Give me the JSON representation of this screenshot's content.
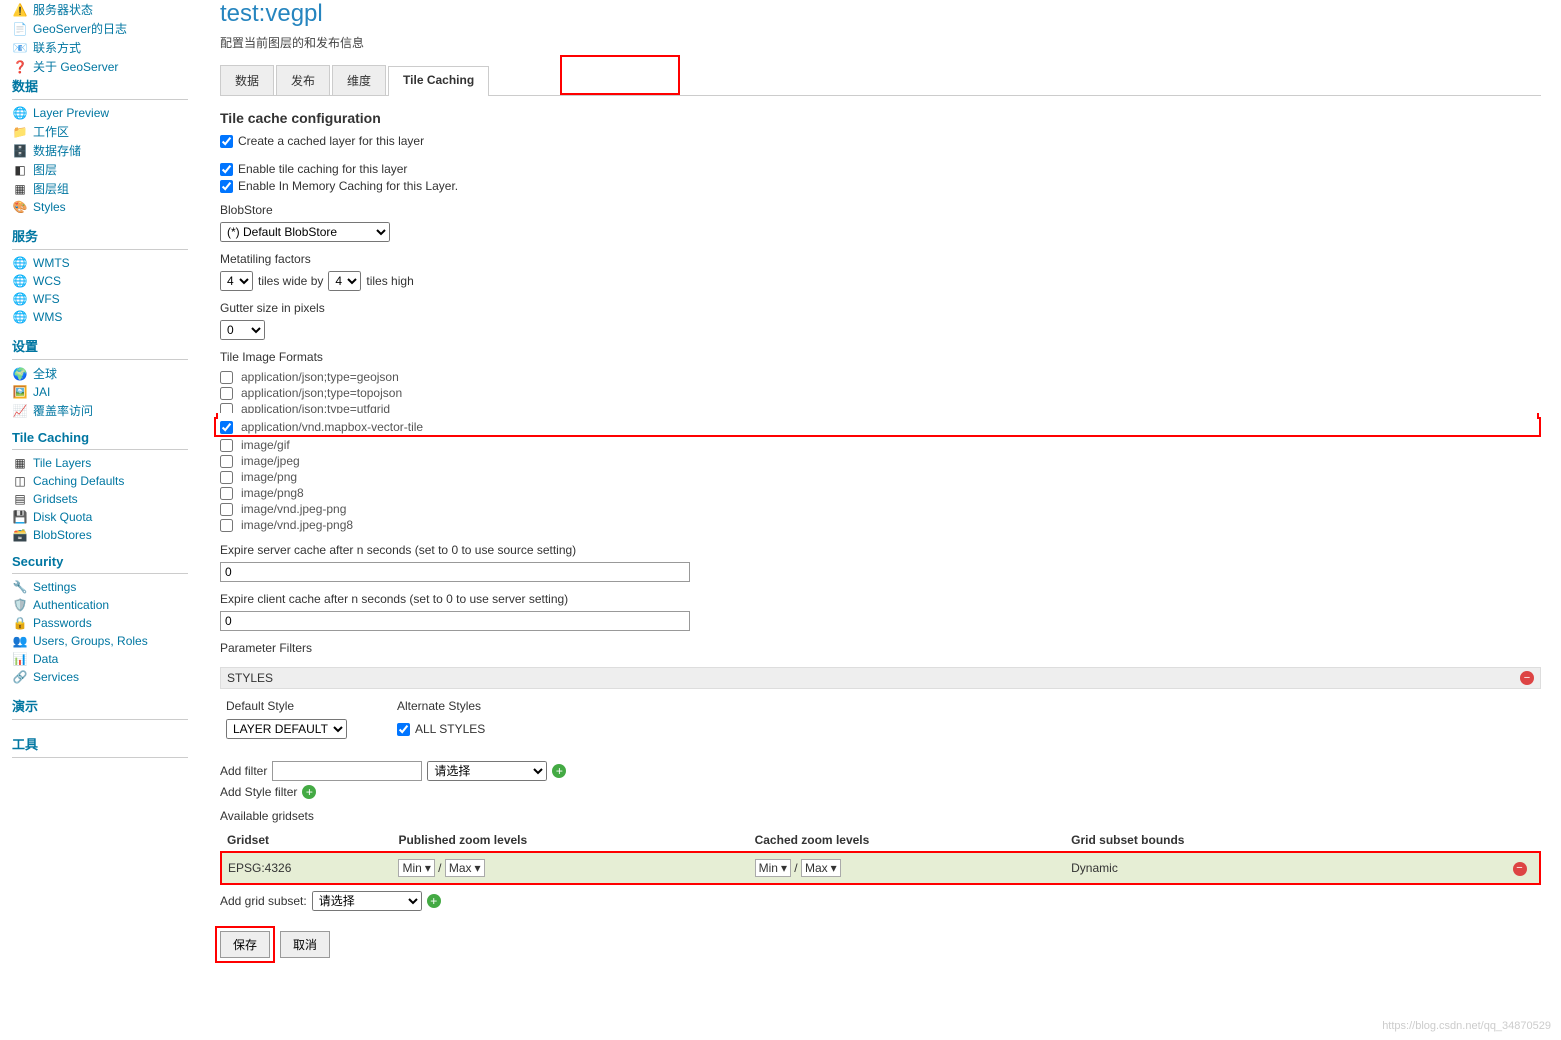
{
  "sidebar": {
    "top": [
      {
        "icon": "⚠️",
        "label": "服务器状态"
      },
      {
        "icon": "📄",
        "label": "GeoServer的日志"
      },
      {
        "icon": "📧",
        "label": "联系方式"
      },
      {
        "icon": "❓",
        "label": "关于 GeoServer"
      }
    ],
    "sections": [
      {
        "title": "数据",
        "items": [
          {
            "icon": "🌐",
            "label": "Layer Preview"
          },
          {
            "icon": "📁",
            "label": "工作区"
          },
          {
            "icon": "🗄️",
            "label": "数据存储"
          },
          {
            "icon": "◧",
            "label": "图层"
          },
          {
            "icon": "▦",
            "label": "图层组"
          },
          {
            "icon": "🎨",
            "label": "Styles"
          }
        ]
      },
      {
        "title": "服务",
        "items": [
          {
            "icon": "🌐",
            "label": "WMTS"
          },
          {
            "icon": "🌐",
            "label": "WCS"
          },
          {
            "icon": "🌐",
            "label": "WFS"
          },
          {
            "icon": "🌐",
            "label": "WMS"
          }
        ]
      },
      {
        "title": "设置",
        "items": [
          {
            "icon": "🌍",
            "label": "全球"
          },
          {
            "icon": "🖼️",
            "label": "JAI"
          },
          {
            "icon": "📈",
            "label": "覆盖率访问"
          }
        ]
      },
      {
        "title": "Tile Caching",
        "items": [
          {
            "icon": "▦",
            "label": "Tile Layers"
          },
          {
            "icon": "◫",
            "label": "Caching Defaults"
          },
          {
            "icon": "▤",
            "label": "Gridsets"
          },
          {
            "icon": "💾",
            "label": "Disk Quota"
          },
          {
            "icon": "🗃️",
            "label": "BlobStores"
          }
        ]
      },
      {
        "title": "Security",
        "items": [
          {
            "icon": "🔧",
            "label": "Settings"
          },
          {
            "icon": "🛡️",
            "label": "Authentication"
          },
          {
            "icon": "🔒",
            "label": "Passwords"
          },
          {
            "icon": "👥",
            "label": "Users, Groups, Roles"
          },
          {
            "icon": "📊",
            "label": "Data"
          },
          {
            "icon": "🔗",
            "label": "Services"
          }
        ]
      },
      {
        "title": "演示",
        "items": []
      },
      {
        "title": "工具",
        "items": []
      }
    ]
  },
  "page": {
    "title": "test:vegpl",
    "desc": "配置当前图层的和发布信息",
    "tabs": [
      "数据",
      "发布",
      "维度",
      "Tile Caching"
    ],
    "section": "Tile cache configuration",
    "cb_create": "Create a cached layer for this layer",
    "cb_enable": "Enable tile caching for this layer",
    "cb_inmem": "Enable In Memory Caching for this Layer.",
    "blobstore_label": "BlobStore",
    "blobstore_value": "(*) Default BlobStore",
    "metatile_label": "Metatiling factors",
    "metatile_wide": "4",
    "metatile_wide_txt": "tiles wide by",
    "metatile_high": "4",
    "metatile_high_txt": "tiles high",
    "gutter_label": "Gutter size in pixels",
    "gutter_value": "0",
    "formats_label": "Tile Image Formats",
    "formats": [
      {
        "label": "application/json;type=geojson",
        "checked": false
      },
      {
        "label": "application/json;type=topojson",
        "checked": false
      },
      {
        "label": "application/json;type=utfgrid",
        "checked": false
      },
      {
        "label": "application/vnd.mapbox-vector-tile",
        "checked": true,
        "hl": true
      },
      {
        "label": "image/gif",
        "checked": false
      },
      {
        "label": "image/jpeg",
        "checked": false
      },
      {
        "label": "image/png",
        "checked": false
      },
      {
        "label": "image/png8",
        "checked": false
      },
      {
        "label": "image/vnd.jpeg-png",
        "checked": false
      },
      {
        "label": "image/vnd.jpeg-png8",
        "checked": false
      }
    ],
    "expire_server_label": "Expire server cache after n seconds (set to 0 to use source setting)",
    "expire_server": "0",
    "expire_client_label": "Expire client cache after n seconds (set to 0 to use server setting)",
    "expire_client": "0",
    "param_filters": "Parameter Filters",
    "styles": "STYLES",
    "default_style": "Default Style",
    "alternate_styles": "Alternate Styles",
    "layer_default": "LAYER DEFAULT",
    "all_styles": "ALL STYLES",
    "add_filter": "Add filter",
    "add_filter_select": "请选择",
    "add_style_filter": "Add Style filter",
    "available_gridsets": "Available gridsets",
    "th": {
      "gridset": "Gridset",
      "published": "Published zoom levels",
      "cached": "Cached zoom levels",
      "bounds": "Grid subset bounds"
    },
    "grid": {
      "name": "EPSG:4326",
      "min": "Min",
      "max": "Max",
      "bounds": "Dynamic"
    },
    "add_grid_subset": "Add grid subset:",
    "add_grid_select": "请选择",
    "save": "保存",
    "cancel": "取消"
  },
  "watermark": "https://blog.csdn.net/qq_34870529"
}
